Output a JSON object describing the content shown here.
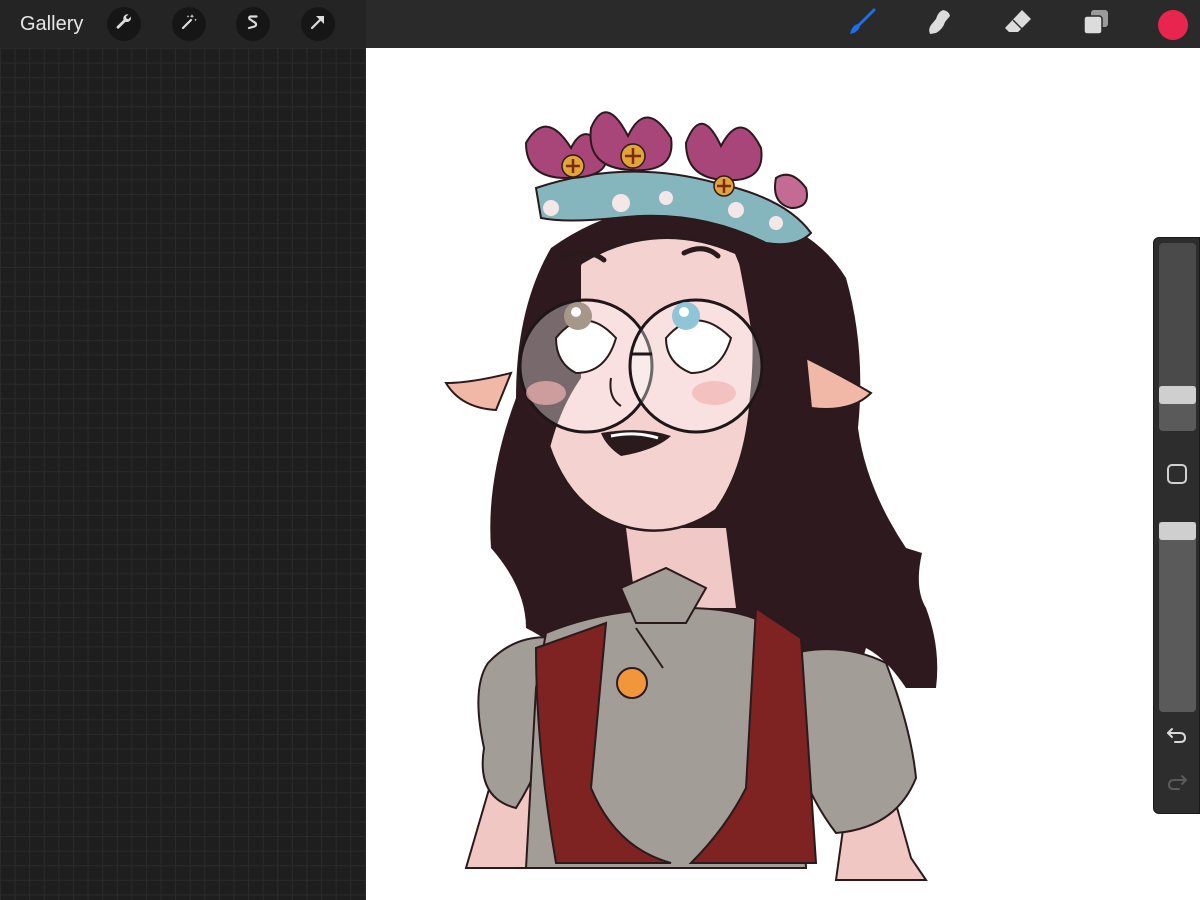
{
  "app": {
    "gallery_label": "Gallery"
  },
  "toolbar_left": {
    "tools": [
      {
        "name": "actions",
        "icon": "wrench-icon"
      },
      {
        "name": "adjustments",
        "icon": "magic-wand-icon"
      },
      {
        "name": "selection",
        "icon": "selection-s-icon"
      },
      {
        "name": "transform",
        "icon": "arrow-cursor-icon"
      }
    ]
  },
  "toolbar_right": {
    "tools": [
      {
        "name": "brush",
        "icon": "brush-icon",
        "active": true
      },
      {
        "name": "smudge",
        "icon": "smudge-finger-icon",
        "active": false
      },
      {
        "name": "eraser",
        "icon": "eraser-icon",
        "active": false
      },
      {
        "name": "layers",
        "icon": "layers-icon",
        "active": false
      }
    ],
    "current_color": "#e8254f"
  },
  "colors": {
    "accent_active": "#1e6ee8",
    "icon": "#dcdcdc"
  },
  "sidebar": {
    "brush_size_level": 0.16,
    "opacity_level": 1.0,
    "modify_icon": "square-icon",
    "undo_icon": "undo-arrow-icon",
    "redo_icon": "redo-arrow-icon"
  }
}
